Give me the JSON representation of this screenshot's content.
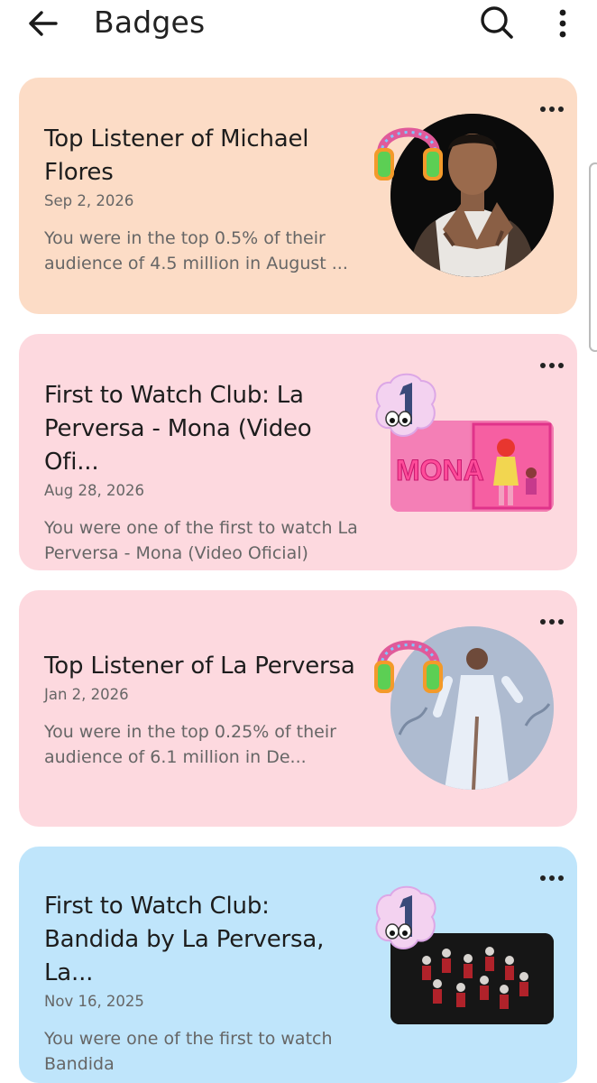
{
  "appbar": {
    "title": "Badges",
    "icons": {
      "back": "arrow-left-icon",
      "search": "search-icon",
      "more": "more-vertical-icon"
    }
  },
  "badges": [
    {
      "title": "Top Listener of Michael Flores",
      "date": "Sep 2, 2026",
      "description": "You were in the top 0.5% of their audience of 4.5 million in August ...",
      "badge_icon": "headphones-badge-icon",
      "thumbnail": "artist-photo-michael-flores",
      "background": "#fcdcc6"
    },
    {
      "title": "First to Watch Club: La Perversa - Mona (Video Ofi...",
      "date": "Aug 28, 2026",
      "description": "You were one of the first to watch La Perversa - Mona (Video Oficial)",
      "badge_icon": "number-one-cloud-badge-icon",
      "thumbnail": "video-thumbnail-mona",
      "thumbnail_text": "MONA",
      "background": "#fdd9df"
    },
    {
      "title": "Top Listener of La Perversa",
      "date": "Jan 2, 2026",
      "description": "You were in the top 0.25% of their audience of 6.1 million in De...",
      "badge_icon": "headphones-badge-icon",
      "thumbnail": "artist-photo-la-perversa",
      "background": "#fdd9df"
    },
    {
      "title": "First to Watch Club: Bandida by La Perversa, La...",
      "date": "Nov 16, 2025",
      "description": "You were one of the first to watch Bandida",
      "badge_icon": "number-one-cloud-badge-icon",
      "thumbnail": "video-thumbnail-bandida",
      "background": "#bfe5fb"
    }
  ]
}
